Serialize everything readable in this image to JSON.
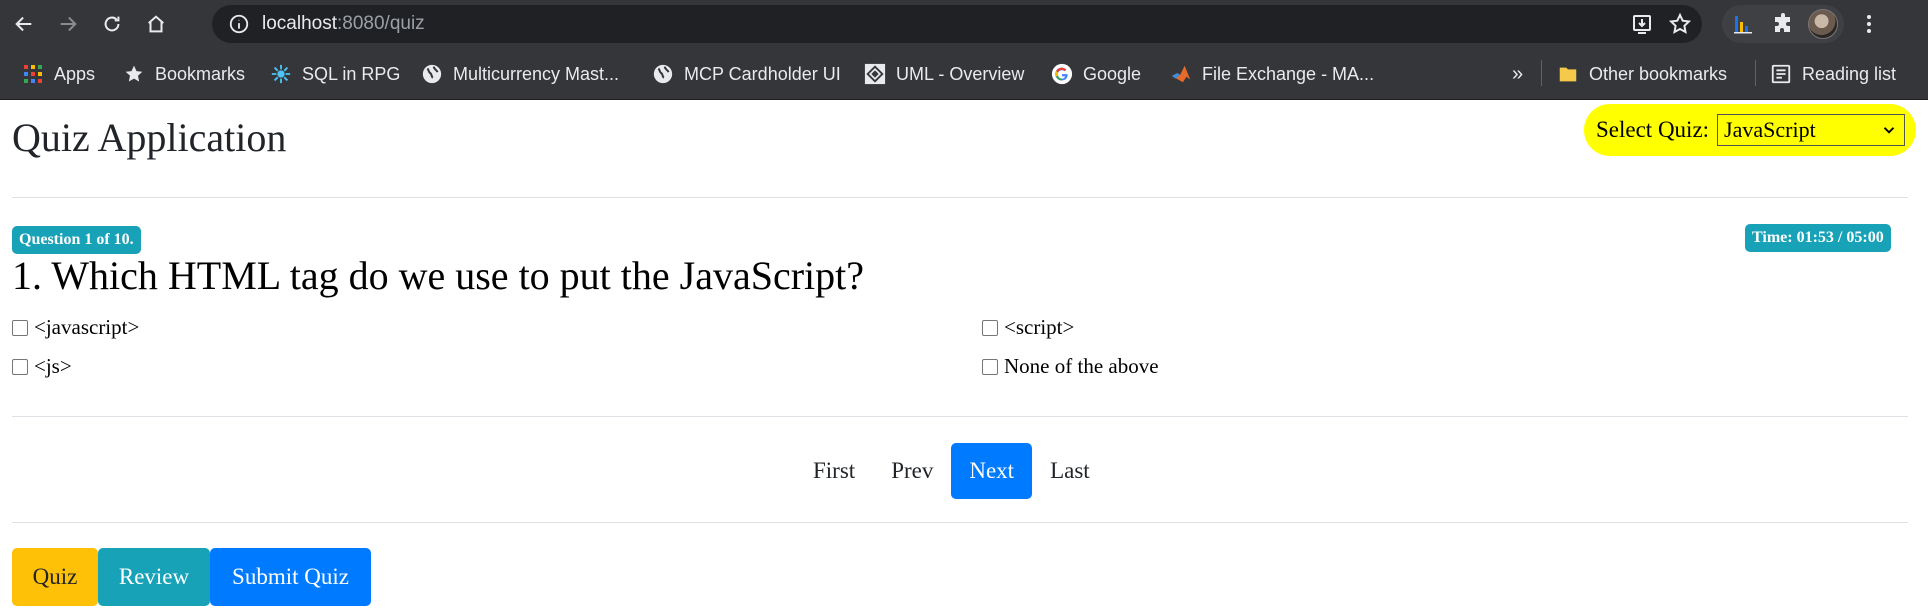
{
  "browser": {
    "url_host": "localhost",
    "url_path": ":8080/quiz",
    "bookmarks": [
      {
        "label": "Apps",
        "icon": "apps-grid-icon"
      },
      {
        "label": "Bookmarks",
        "icon": "star-icon"
      },
      {
        "label": "SQL in RPG",
        "icon": "sql-icon"
      },
      {
        "label": "Multicurrency Mast...",
        "icon": "globe-icon"
      },
      {
        "label": "MCP Cardholder UI",
        "icon": "globe-icon"
      },
      {
        "label": "UML - Overview",
        "icon": "uml-icon"
      },
      {
        "label": "Google",
        "icon": "google-icon"
      },
      {
        "label": "File Exchange - MA...",
        "icon": "matlab-icon"
      }
    ],
    "overflow_label": "»",
    "other_bookmarks": "Other bookmarks",
    "reading_list": "Reading list"
  },
  "app": {
    "title": "Quiz Application",
    "select_label": "Select Quiz:",
    "selected_quiz": "JavaScript"
  },
  "question": {
    "counter": "Question 1 of 10.",
    "timer": "Time: 01:53 / 05:00",
    "text": "1. Which HTML tag do we use to put the JavaScript?",
    "options": [
      "<javascript>",
      "<script>",
      "<js>",
      "None of the above"
    ],
    "checked": [
      false,
      false,
      false,
      false
    ]
  },
  "pager": {
    "first": "First",
    "prev": "Prev",
    "next": "Next",
    "last": "Last",
    "active": "Next"
  },
  "actions": {
    "quiz": "Quiz",
    "review": "Review",
    "submit": "Submit Quiz"
  },
  "colors": {
    "primary": "#007bff",
    "info": "#17a2b8",
    "warning": "#ffc107",
    "highlight": "#ffff00"
  }
}
